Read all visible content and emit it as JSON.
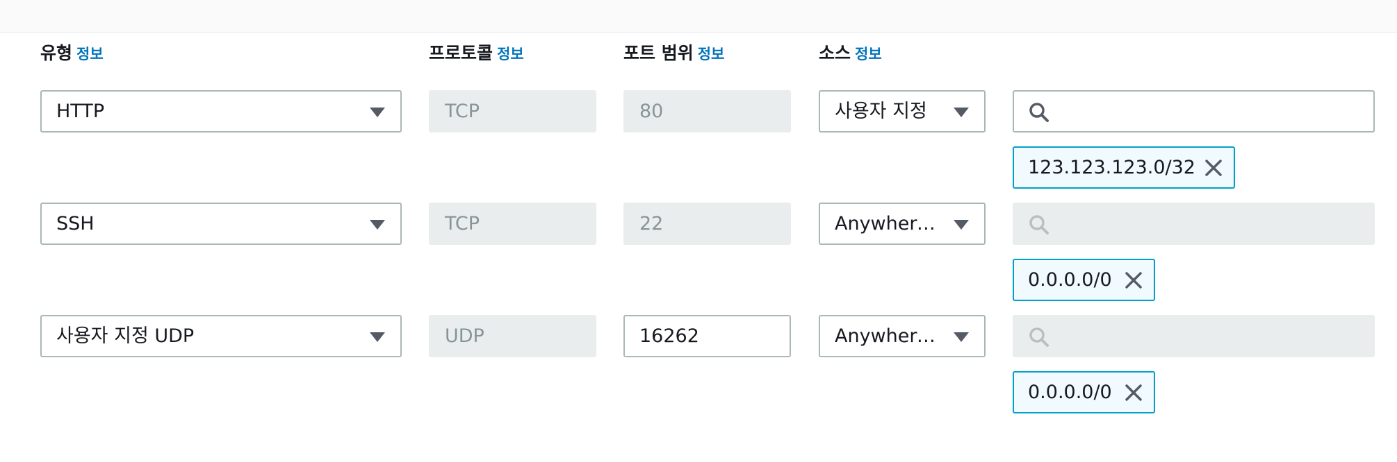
{
  "headers": {
    "type": "유형",
    "protocol": "프로토콜",
    "port_range": "포트 범위",
    "source": "소스",
    "info_link": "정보"
  },
  "rules": [
    {
      "type": "HTTP",
      "protocol": "TCP",
      "port": "80",
      "port_editable": false,
      "source": "사용자 지정",
      "search_disabled": false,
      "cidr": "123.123.123.0/32"
    },
    {
      "type": "SSH",
      "protocol": "TCP",
      "port": "22",
      "port_editable": false,
      "source": "Anywhere…",
      "search_disabled": true,
      "cidr": "0.0.0.0/0"
    },
    {
      "type": "사용자 지정 UDP",
      "protocol": "UDP",
      "port": "16262",
      "port_editable": true,
      "source": "Anywhere…",
      "search_disabled": true,
      "cidr": "0.0.0.0/0"
    }
  ],
  "icons": {
    "search": "search-icon",
    "dropdown": "caret-down-icon",
    "remove": "close-icon"
  },
  "colors": {
    "link": "#0073bb",
    "token_border": "#00a1c9",
    "token_bg": "#f1faff",
    "disabled_bg": "#eaeded"
  }
}
